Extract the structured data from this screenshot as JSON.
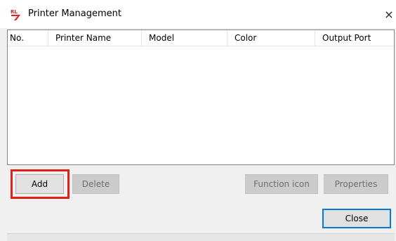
{
  "window": {
    "title": "Printer Management",
    "close_glyph": "×"
  },
  "app_icon": {
    "name": "app-logo-icon",
    "colors": {
      "red": "#d9251c",
      "orange": "#f08c00"
    }
  },
  "list": {
    "columns": [
      "No.",
      "Printer Name",
      "Model",
      "Color",
      "Output Port"
    ],
    "rows": []
  },
  "buttons": {
    "add": "Add",
    "delete": "Delete",
    "function_icon": "Function icon",
    "properties": "Properties",
    "close": "Close"
  },
  "highlight": {
    "target": "add",
    "color": "#e0201a"
  }
}
